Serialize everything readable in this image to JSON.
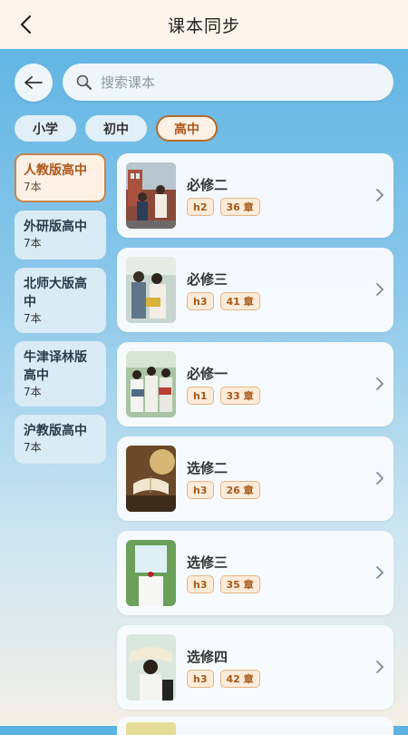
{
  "header": {
    "title": "课本同步"
  },
  "search": {
    "placeholder": "搜索课本"
  },
  "levels": [
    {
      "label": "小学",
      "active": false
    },
    {
      "label": "初中",
      "active": false
    },
    {
      "label": "高中",
      "active": true
    }
  ],
  "publishers": [
    {
      "name": "人教版高中",
      "count": "7本",
      "active": true
    },
    {
      "name": "外研版高中",
      "count": "7本",
      "active": false
    },
    {
      "name": "北师大版高中",
      "count": "7本",
      "active": false
    },
    {
      "name": "牛津译林版高中",
      "count": "7本",
      "active": false
    },
    {
      "name": "沪教版高中",
      "count": "7本",
      "active": false
    }
  ],
  "books": [
    {
      "title": "必修二",
      "grade": "h2",
      "chapters": "36 章"
    },
    {
      "title": "必修三",
      "grade": "h3",
      "chapters": "41 章"
    },
    {
      "title": "必修一",
      "grade": "h1",
      "chapters": "33 章"
    },
    {
      "title": "选修二",
      "grade": "h3",
      "chapters": "26 章"
    },
    {
      "title": "选修三",
      "grade": "h3",
      "chapters": "35 章"
    },
    {
      "title": "选修四",
      "grade": "h3",
      "chapters": "42 章"
    }
  ],
  "colors": {
    "accent": "#b0561b",
    "header_bg": "#fdf4ec"
  }
}
